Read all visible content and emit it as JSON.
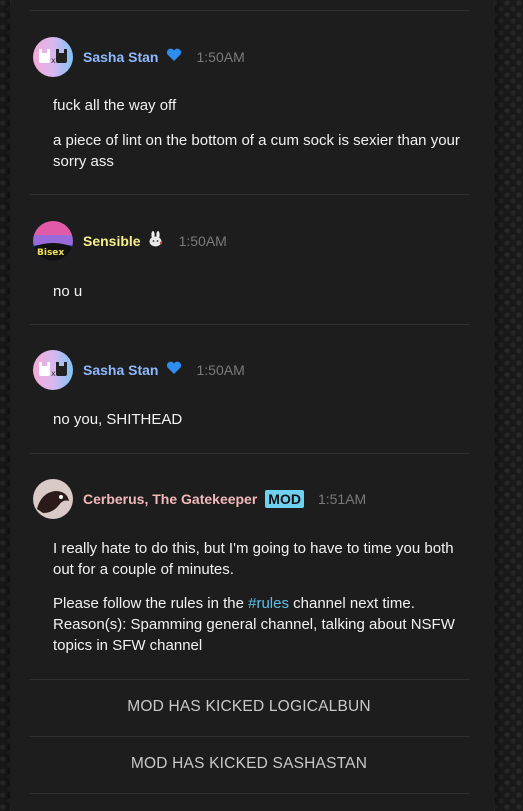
{
  "messages": [
    {
      "author": "Sasha Stan",
      "author_color": "#8fb9ff",
      "time": "1:50AM",
      "lines": [
        "fuck all the way off",
        "a piece of lint on the bottom of a cum sock is sexier than your sorry ass"
      ],
      "badge_icon": "blue-heart-icon"
    },
    {
      "author": "Sensible",
      "author_color": "#f7f08a",
      "time": "1:50AM",
      "lines": [
        "no u"
      ],
      "badge_icon": "rabbit-icon"
    },
    {
      "author": "Sasha Stan",
      "author_color": "#8fb9ff",
      "time": "1:50AM",
      "lines": [
        "no you, SHITHEAD"
      ],
      "badge_icon": "blue-heart-icon"
    },
    {
      "author": "Cerberus, The Gatekeeper",
      "author_color": "#f3b8b8",
      "badge": "MOD",
      "time": "1:51AM",
      "line1": "I really hate to do this, but I'm going to have to time you both out for a couple of minutes.",
      "line2_before": "Please follow the rules in the ",
      "line2_link": "#rules",
      "line2_after": " channel next time. Reason(s): Spamming general channel, talking about NSFW topics in SFW channel"
    }
  ],
  "system_events": [
    "MOD HAS KICKED LOGICALBUN",
    "MOD HAS KICKED SASHASTAN"
  ],
  "colors": {
    "link": "#5ec0e8",
    "mod_badge": "#6fd0f0",
    "timestamp": "#7a7a7a"
  }
}
